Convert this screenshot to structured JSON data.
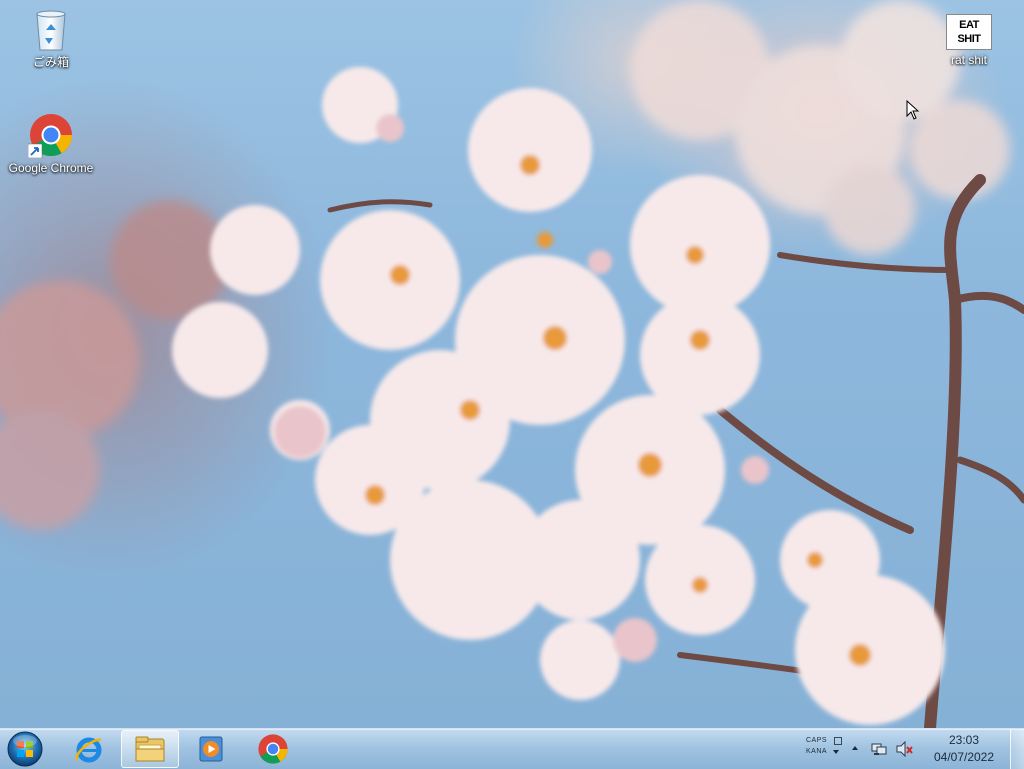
{
  "desktop": {
    "icons": [
      {
        "label": "ごみ箱",
        "icon": "recycle-bin-icon"
      },
      {
        "label": "Google Chrome",
        "icon": "chrome-icon"
      },
      {
        "label": "rat shit",
        "icon": "image-file-icon",
        "thumbnail_text": "EAT SHIT"
      }
    ],
    "wallpaper": "cherry-blossom"
  },
  "taskbar": {
    "start": "start-orb-icon",
    "pinned": [
      {
        "name": "internet-explorer",
        "icon": "internet-explorer-icon",
        "active": false
      },
      {
        "name": "windows-explorer",
        "icon": "folder-icon",
        "active": true
      },
      {
        "name": "media-player",
        "icon": "media-player-icon",
        "active": false
      },
      {
        "name": "google-chrome",
        "icon": "chrome-icon",
        "active": false
      }
    ],
    "tray": {
      "caps": "CAPS",
      "kana": "KANA",
      "time": "23:03",
      "date": "04/07/2022"
    }
  },
  "colors": {
    "sky": "#8db7dc",
    "blossom": "#f6e6e6",
    "taskbar": "#a8c8e6"
  }
}
